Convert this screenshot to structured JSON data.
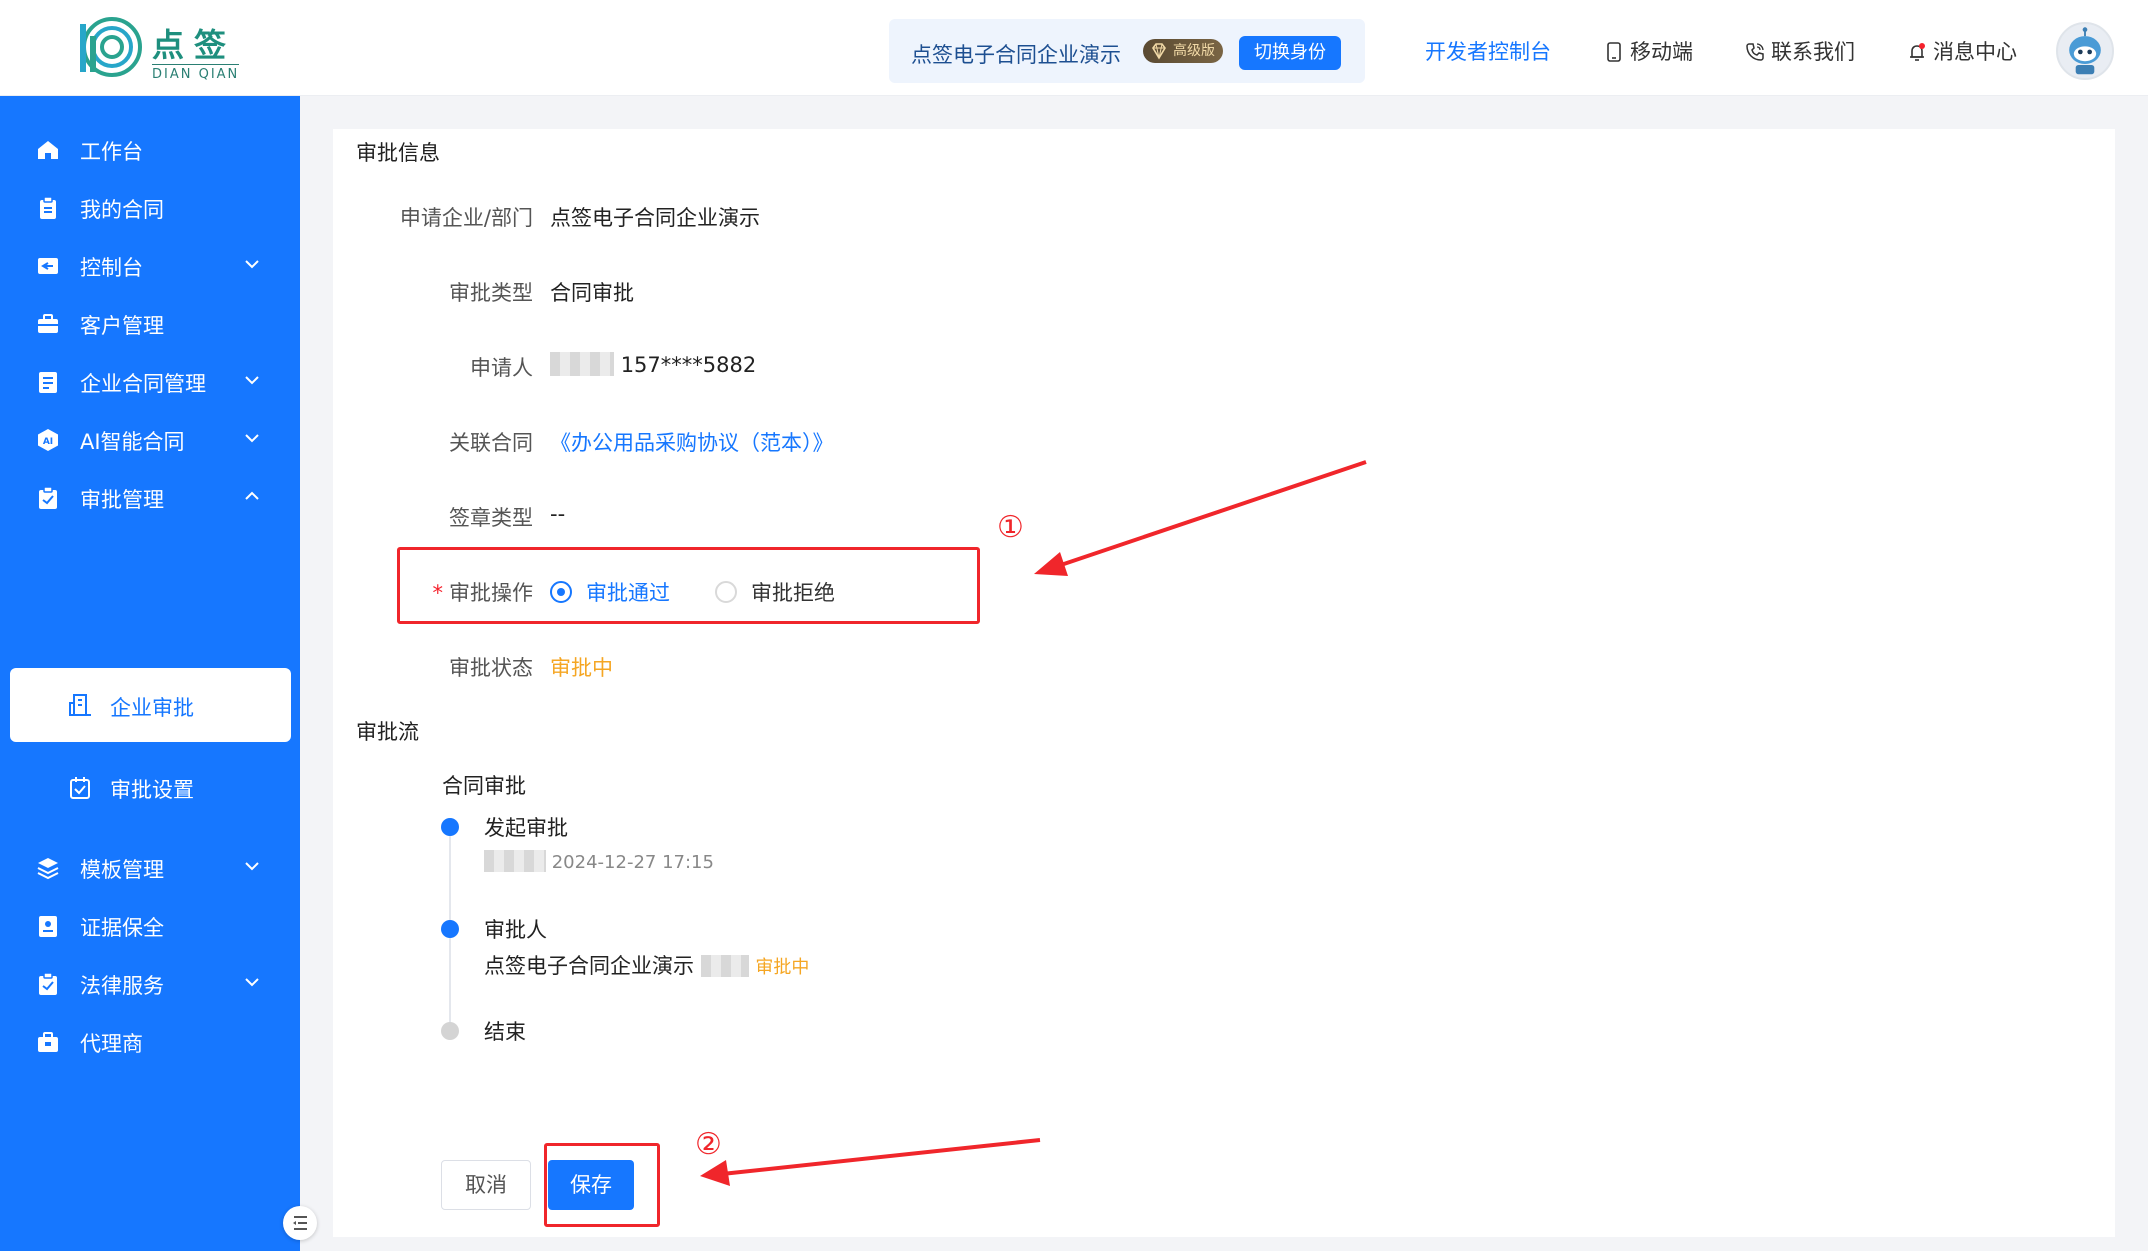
{
  "header": {
    "logo_cn": "点签",
    "logo_en": "DIAN QIAN",
    "identity_name": "点签电子合同企业演示",
    "vip_label": "高级版",
    "switch_label": "切换身份",
    "nav": {
      "developer": "开发者控制台",
      "mobile": "移动端",
      "contact": "联系我们",
      "messages": "消息中心"
    }
  },
  "sidebar": {
    "items": [
      {
        "label": "工作台"
      },
      {
        "label": "我的合同"
      },
      {
        "label": "控制台"
      },
      {
        "label": "客户管理"
      },
      {
        "label": "企业合同管理"
      },
      {
        "label": "AI智能合同"
      },
      {
        "label": "审批管理"
      },
      {
        "label": "企业审批"
      },
      {
        "label": "审批设置"
      },
      {
        "label": "模板管理"
      },
      {
        "label": "证据保全"
      },
      {
        "label": "法律服务"
      },
      {
        "label": "代理商"
      }
    ]
  },
  "approval_info": {
    "section_title": "审批信息",
    "fields": {
      "dept_label": "申请企业/部门",
      "dept_value": "点签电子合同企业演示",
      "type_label": "审批类型",
      "type_value": "合同审批",
      "applicant_label": "申请人",
      "applicant_phone": "157****5882",
      "contract_label": "关联合同",
      "contract_value": "《办公用品采购协议（范本）》",
      "seal_label": "签章类型",
      "seal_value": "--",
      "action_label": "审批操作",
      "action_approve": "审批通过",
      "action_reject": "审批拒绝",
      "status_label": "审批状态",
      "status_value": "审批中"
    }
  },
  "approval_flow": {
    "section_title": "审批流",
    "flow_name": "合同审批",
    "steps": [
      {
        "title": "发起审批",
        "time": "2024-12-27 17:15"
      },
      {
        "title": "审批人",
        "detail": "点签电子合同企业演示",
        "status": "审批中"
      },
      {
        "title": "结束"
      }
    ]
  },
  "buttons": {
    "cancel": "取消",
    "save": "保存"
  },
  "annotations": {
    "marker_1": "①",
    "marker_2": "②"
  },
  "colors": {
    "primary": "#1677ff",
    "warning": "#f5a623",
    "annotation": "#f0262b"
  }
}
